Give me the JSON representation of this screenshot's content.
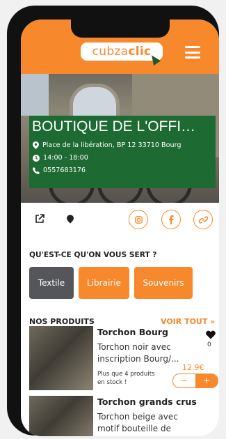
{
  "header": {
    "logo_part1": "cubza",
    "logo_part2": "clic",
    "brand_color": "#f7892c"
  },
  "shop": {
    "title": "BOUTIQUE DE L'OFFI…",
    "address": "Place de la libération, BP 12 33710 Bourg",
    "hours": "14:00 - 18:00",
    "phone": "0557683176"
  },
  "actions": {
    "external_link_icon": "external-link-icon",
    "map_pin_icon": "map-pin-icon",
    "instagram_icon": "instagram-icon",
    "facebook_icon": "facebook-icon",
    "link_icon": "link-icon"
  },
  "services": {
    "heading": "QU'EST-CE QU'ON VOUS SERT ?",
    "tags": [
      "Textile",
      "Librairie",
      "Souvenirs"
    ]
  },
  "products": {
    "heading": "NOS PRODUITS",
    "see_all": "VOIR TOUT »",
    "items": [
      {
        "name": "Torchon Bourg",
        "desc_line1": "Torchon noir avec",
        "desc_line2": "inscription Bourg/...",
        "stock_line1": "Plus que 4 produits",
        "stock_line2": "en stock !",
        "price": "12.9€",
        "favorites": "0"
      },
      {
        "name": "Torchon grands crus",
        "desc_line1": "Torchon beige avec",
        "desc_line2": "motif bouteille de vin..."
      }
    ],
    "minus": "−",
    "plus": "+"
  }
}
